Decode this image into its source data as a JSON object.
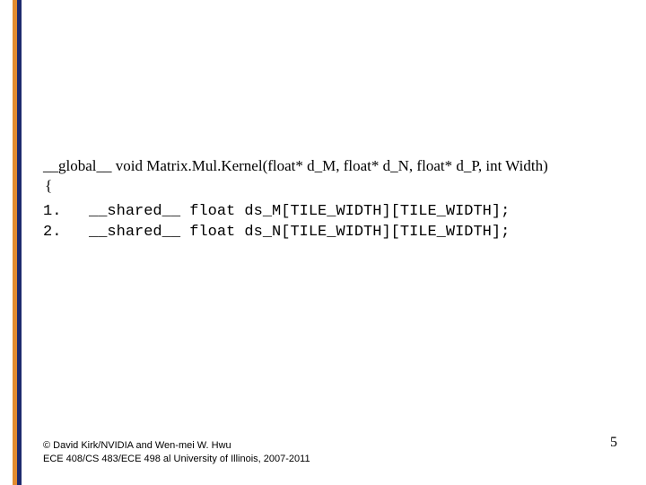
{
  "slide": {
    "decl": "__global__ void Matrix.Mul.Kernel(float* d_M, float* d_N, float* d_P, int Width)",
    "brace": "{",
    "code_line_1": "1.   __shared__ float ds_M[TILE_WIDTH][TILE_WIDTH];",
    "code_line_2": "2.   __shared__ float ds_N[TILE_WIDTH][TILE_WIDTH];"
  },
  "footer": {
    "line1": "© David Kirk/NVIDIA and Wen-mei W. Hwu",
    "line2": "ECE 408/CS 483/ECE 498 al University of Illinois, 2007-2011"
  },
  "page_number": "5"
}
